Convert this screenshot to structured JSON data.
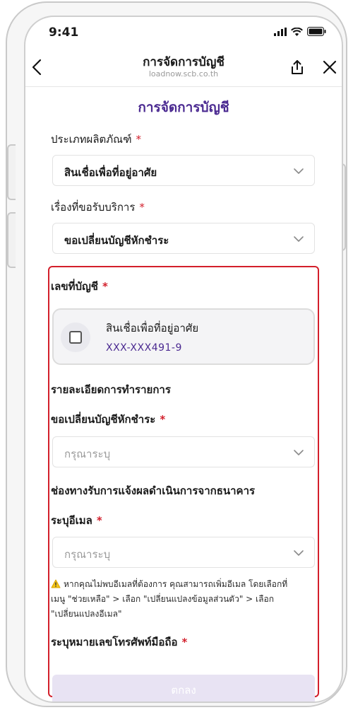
{
  "status_bar": {
    "time": "9:41"
  },
  "nav": {
    "title": "การจัดการบัญชี",
    "url": "loadnow.scb.co.th"
  },
  "form": {
    "page_title": "การจัดการบัญชี",
    "product_type": {
      "label": "ประเภทผลิตภัณฑ์",
      "required": "*",
      "value": "สินเชื่อเพื่อที่อยู่อาศัย"
    },
    "service_topic": {
      "label": "เรื่องที่ขอรับบริการ",
      "required": "*",
      "value": "ขอเปลี่ยนบัญชีหักชำระ"
    },
    "account_number": {
      "label": "เลขที่บัญชี",
      "required": "*",
      "card": {
        "name": "สินเชื่อเพื่อที่อยู่อาศัย",
        "number": "XXX-XXX491-9",
        "checked": false
      }
    },
    "transaction_details": {
      "heading": "รายละเอียดการทำรายการ"
    },
    "change_debit_account": {
      "label": "ขอเปลี่ยนบัญชีหักชำระ",
      "required": "*",
      "placeholder": "กรุณาระบุ"
    },
    "notification_channel": {
      "heading": "ช่องทางรับการแจ้งผลดำเนินการจากธนาคาร"
    },
    "email": {
      "label": "ระบุอีเมล",
      "required": "*",
      "placeholder": "กรุณาระบุ"
    },
    "email_warning": {
      "line1": "หากคุณไม่พบอีเมลที่ต้องการ คุณสามารถเพิ่มอีเมล โดยเลือกที่",
      "line2": "เมนู \"ช่วยเหลือ\" > เลือก \"เปลี่ยนแปลงข้อมูลส่วนตัว\" > เลือก",
      "line3": "\"เปลี่ยนแปลงอีเมล\""
    },
    "mobile": {
      "label": "ระบุหมายเลขโทรศัพท์มือถือ",
      "required": "*"
    },
    "submit_label": "ตกลง"
  },
  "colors": {
    "brand_purple": "#4b2a91",
    "required_red": "#d21f2b",
    "highlight_border": "#d31f2b",
    "disabled_button": "#e8e3f3"
  },
  "icons": {
    "back": "chevron-left-icon",
    "share": "share-icon",
    "close": "close-icon",
    "dropdown": "chevron-down-icon",
    "warning": "warning-icon"
  }
}
